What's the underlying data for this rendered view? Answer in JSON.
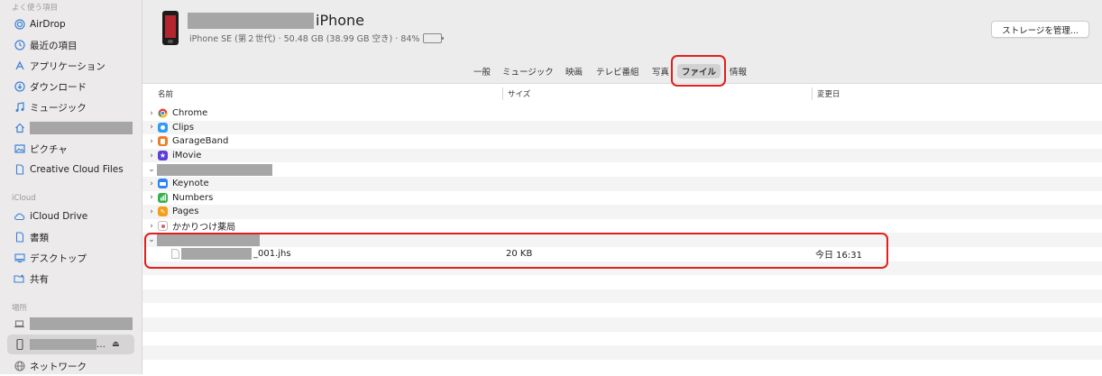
{
  "sidebar": {
    "favorites_header": "よく使う項目",
    "items": [
      {
        "label": "AirDrop",
        "icon": "airdrop-icon"
      },
      {
        "label": "最近の項目",
        "icon": "clock-icon"
      },
      {
        "label": "アプリケーション",
        "icon": "applications-icon"
      },
      {
        "label": "ダウンロード",
        "icon": "download-icon"
      },
      {
        "label": "ミュージック",
        "icon": "music-note-icon"
      },
      {
        "label": "",
        "icon": "home-icon"
      },
      {
        "label": "ピクチャ",
        "icon": "pictures-icon"
      },
      {
        "label": "Creative Cloud Files",
        "icon": "document-icon"
      }
    ],
    "icloud_header": "iCloud",
    "icloud_items": [
      {
        "label": "iCloud Drive",
        "icon": "cloud-icon"
      },
      {
        "label": "書類",
        "icon": "document-icon"
      },
      {
        "label": "デスクトップ",
        "icon": "desktop-icon"
      },
      {
        "label": "共有",
        "icon": "shared-folder-icon"
      }
    ],
    "locations_header": "場所",
    "location_items": [
      {
        "label": "",
        "icon": "laptop-icon"
      },
      {
        "label": "…",
        "icon": "iphone-icon"
      },
      {
        "label": "ネットワーク",
        "icon": "network-icon"
      }
    ]
  },
  "device": {
    "name": "iPhone",
    "info": "iPhone SE (第２世代) · 50.48 GB (38.99 GB 空き) · 84%",
    "battery_percent": 84,
    "battery_color": "#3cc74a",
    "storage_button": "ストレージを管理..."
  },
  "tabs": [
    {
      "label": "一般"
    },
    {
      "label": "ミュージック"
    },
    {
      "label": "映画"
    },
    {
      "label": "テレビ番組"
    },
    {
      "label": "写真"
    },
    {
      "label": "ファイル",
      "active": true
    },
    {
      "label": "情報"
    }
  ],
  "table": {
    "columns": {
      "name": "名前",
      "size": "サイズ",
      "date": "変更日"
    },
    "rows": [
      {
        "name": "Chrome",
        "chevron": "›",
        "icon": "chrome-icon",
        "size": "",
        "date": ""
      },
      {
        "name": "Clips",
        "chevron": "›",
        "icon": "clips-icon",
        "size": "",
        "date": ""
      },
      {
        "name": "GarageBand",
        "chevron": "›",
        "icon": "garageband-icon",
        "size": "",
        "date": ""
      },
      {
        "name": "iMovie",
        "chevron": "›",
        "icon": "imovie-icon",
        "size": "",
        "date": ""
      },
      {
        "name": "",
        "chevron": "⌄",
        "icon": "",
        "size": "",
        "date": ""
      },
      {
        "name": "Keynote",
        "chevron": "›",
        "icon": "keynote-icon",
        "size": "",
        "date": ""
      },
      {
        "name": "Numbers",
        "chevron": "›",
        "icon": "numbers-icon",
        "size": "",
        "date": ""
      },
      {
        "name": "Pages",
        "chevron": "›",
        "icon": "pages-icon",
        "size": "",
        "date": ""
      },
      {
        "name": "かかりつけ薬局",
        "chevron": "›",
        "icon": "pharmacy-icon",
        "size": "",
        "date": ""
      },
      {
        "name": "",
        "chevron": "⌄",
        "icon": "",
        "size": "",
        "date": ""
      },
      {
        "name": "_001.jhs",
        "chevron": "",
        "icon": "file-icon",
        "size": "20 KB",
        "date": "今日 16:31"
      }
    ]
  },
  "colors": {
    "highlight_red": "#e0201c",
    "accent_blue": "#3b82d6"
  }
}
